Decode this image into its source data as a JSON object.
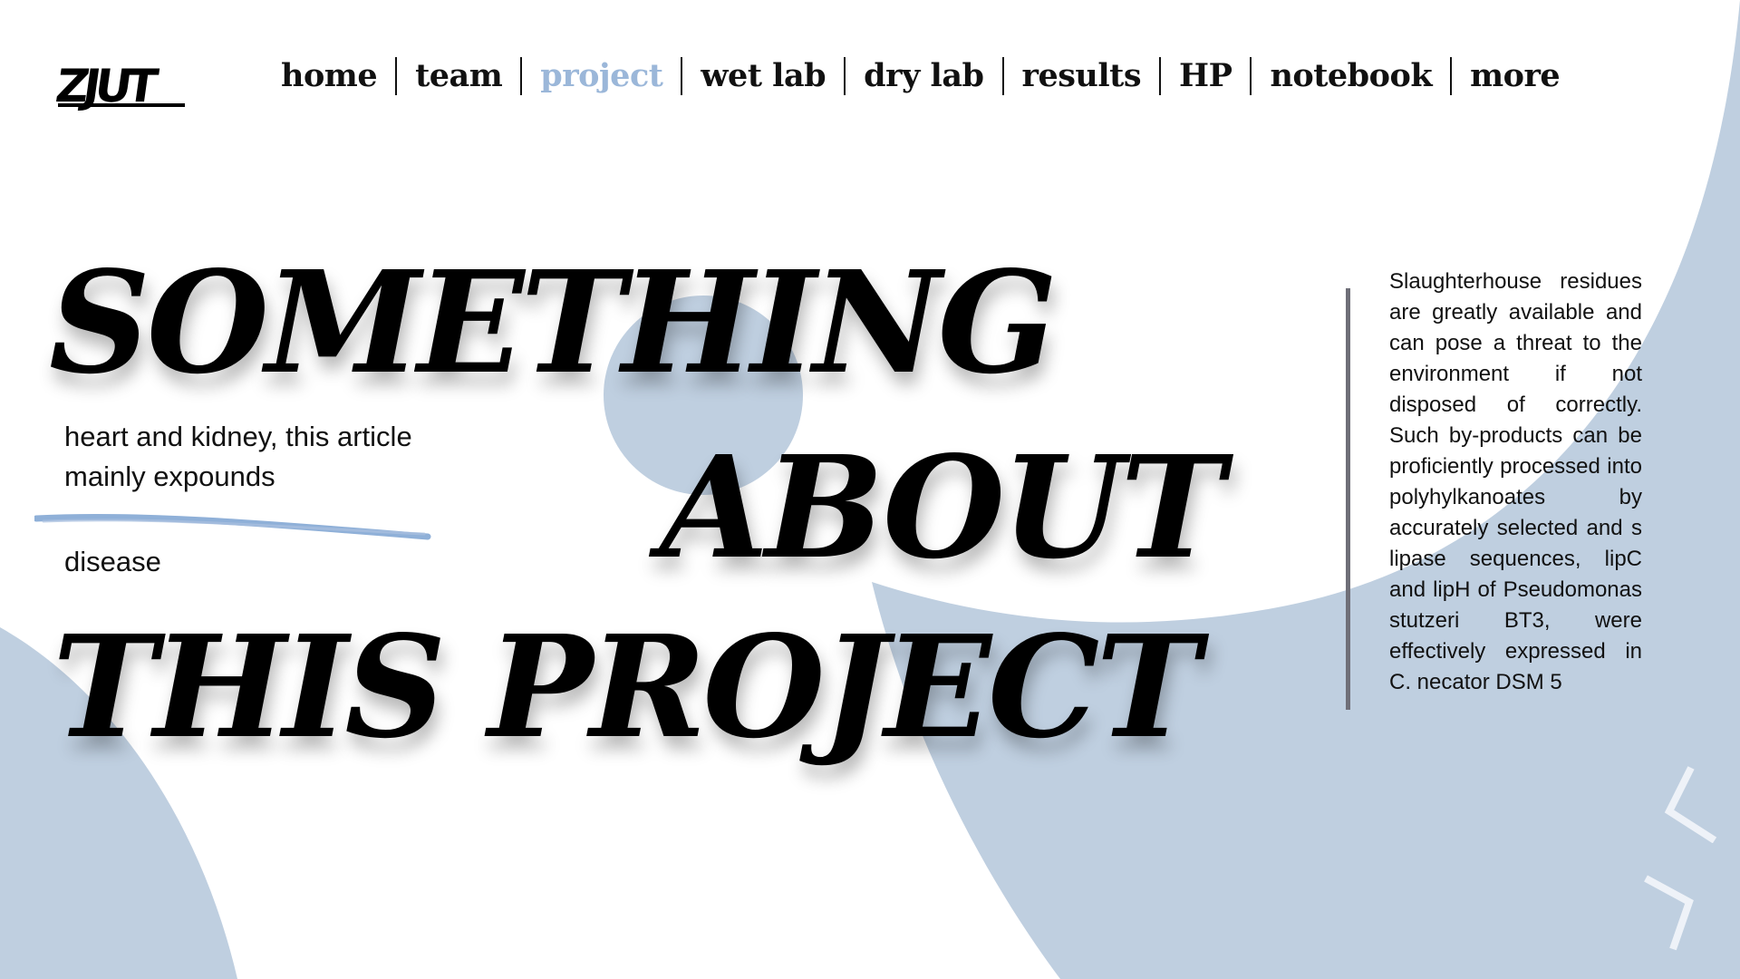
{
  "brand": {
    "logo_text": "ZJUT"
  },
  "nav": {
    "items": [
      {
        "label": "home",
        "active": false
      },
      {
        "label": "team",
        "active": false
      },
      {
        "label": "project",
        "active": true
      },
      {
        "label": "wet lab",
        "active": false
      },
      {
        "label": "dry lab",
        "active": false
      },
      {
        "label": "results",
        "active": false
      },
      {
        "label": "HP",
        "active": false
      },
      {
        "label": "notebook",
        "active": false
      },
      {
        "label": "more",
        "active": false
      }
    ]
  },
  "hero": {
    "line1": "SOMETHING",
    "line2": "ABOUT",
    "line3": "THIS PROJECT"
  },
  "intro": {
    "line1": "heart and kidney, this article",
    "line2": "mainly expounds",
    "line3": "disease"
  },
  "description": "Slaughterhouse residues are greatly available and can pose a threat to the environment if not disposed of correctly. Such by-products can be proficiently processed into polyhylkanoates by accurately selected and s lipase sequences, lipC and lipH of Pseudomonas stutzeri BT3, were effectively expressed in C. necator DSM 5",
  "controls": {
    "prev_icon": "chevron-left-icon",
    "next_icon": "chevron-right-icon"
  },
  "colors": {
    "accent": "#9bb7d9",
    "shape": "#bfcfe0",
    "text": "#111111"
  }
}
